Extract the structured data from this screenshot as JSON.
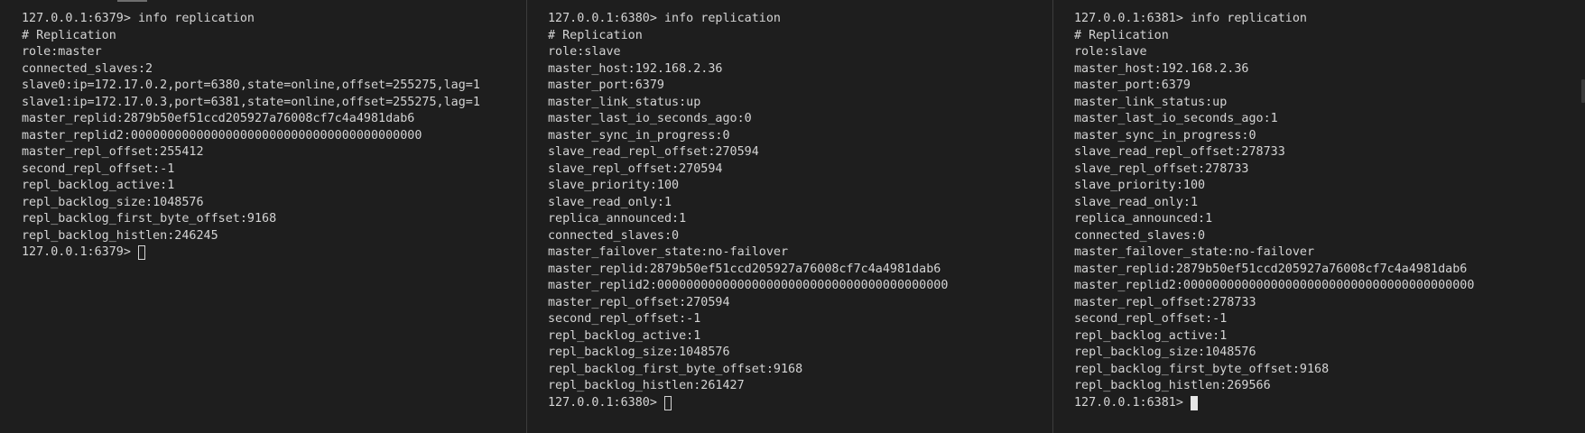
{
  "panes": [
    {
      "lines": [
        "127.0.0.1:6379> info replication",
        "# Replication",
        "role:master",
        "connected_slaves:2",
        "slave0:ip=172.17.0.2,port=6380,state=online,offset=255275,lag=1",
        "slave1:ip=172.17.0.3,port=6381,state=online,offset=255275,lag=1",
        "master_replid:2879b50ef51ccd205927a76008cf7c4a4981dab6",
        "master_replid2:0000000000000000000000000000000000000000",
        "master_repl_offset:255412",
        "second_repl_offset:-1",
        "repl_backlog_active:1",
        "repl_backlog_size:1048576",
        "repl_backlog_first_byte_offset:9168",
        "repl_backlog_histlen:246245"
      ],
      "prompt": "127.0.0.1:6379>",
      "cursor_style": "hollow"
    },
    {
      "lines": [
        "127.0.0.1:6380> info replication",
        "# Replication",
        "role:slave",
        "master_host:192.168.2.36",
        "master_port:6379",
        "master_link_status:up",
        "master_last_io_seconds_ago:0",
        "master_sync_in_progress:0",
        "slave_read_repl_offset:270594",
        "slave_repl_offset:270594",
        "slave_priority:100",
        "slave_read_only:1",
        "replica_announced:1",
        "connected_slaves:0",
        "master_failover_state:no-failover",
        "master_replid:2879b50ef51ccd205927a76008cf7c4a4981dab6",
        "master_replid2:0000000000000000000000000000000000000000",
        "master_repl_offset:270594",
        "second_repl_offset:-1",
        "repl_backlog_active:1",
        "repl_backlog_size:1048576",
        "repl_backlog_first_byte_offset:9168",
        "repl_backlog_histlen:261427"
      ],
      "prompt": "127.0.0.1:6380>",
      "cursor_style": "hollow"
    },
    {
      "lines": [
        "127.0.0.1:6381> info replication",
        "# Replication",
        "role:slave",
        "master_host:192.168.2.36",
        "master_port:6379",
        "master_link_status:up",
        "master_last_io_seconds_ago:1",
        "master_sync_in_progress:0",
        "slave_read_repl_offset:278733",
        "slave_repl_offset:278733",
        "slave_priority:100",
        "slave_read_only:1",
        "replica_announced:1",
        "connected_slaves:0",
        "master_failover_state:no-failover",
        "master_replid:2879b50ef51ccd205927a76008cf7c4a4981dab6",
        "master_replid2:0000000000000000000000000000000000000000",
        "master_repl_offset:278733",
        "second_repl_offset:-1",
        "repl_backlog_active:1",
        "repl_backlog_size:1048576",
        "repl_backlog_first_byte_offset:9168",
        "repl_backlog_histlen:269566"
      ],
      "prompt": "127.0.0.1:6381>",
      "cursor_style": "solid"
    }
  ],
  "colors": {
    "background": "#1e1e1e",
    "text": "#d4d4d4",
    "divider": "#3c3c3c"
  }
}
